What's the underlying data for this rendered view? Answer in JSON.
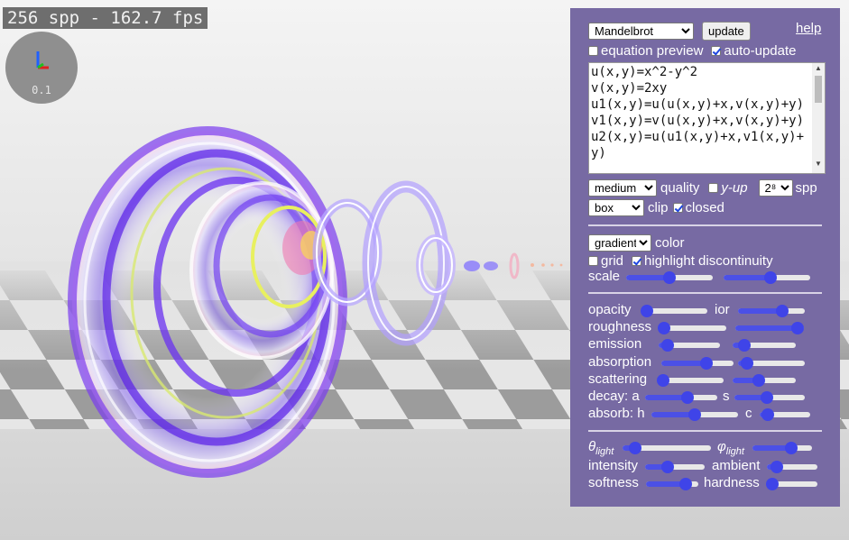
{
  "status": {
    "fps_text": "256 spp - 162.7 fps"
  },
  "gizmo": {
    "scale_label": "0.1"
  },
  "colors": {
    "panel_bg": "#776aa3",
    "slider_accent": "#3f44e8",
    "axis_x": "#e02020",
    "axis_y": "#2060ff",
    "axis_z": "#20c020"
  },
  "panel": {
    "preset": "Mandelbrot",
    "update_label": "update",
    "help_label": "help",
    "equation_preview": {
      "label": "equation preview",
      "checked": false
    },
    "auto_update": {
      "label": "auto-update",
      "checked": true
    },
    "equation_text": "u(x,y)=x^2-y^2\nv(x,y)=2xy\nu1(x,y)=u(u(x,y)+x,v(x,y)+y)\nv1(x,y)=v(u(x,y)+x,v(x,y)+y)\nu2(x,y)=u(u1(x,y)+x,v1(x,y)+y)",
    "quality_select": "medium",
    "quality_label": "quality",
    "y_up": {
      "label": "y-up",
      "checked": false
    },
    "spp_select": "2⁸",
    "spp_label": "spp",
    "clip_select": "box",
    "clip_label": "clip",
    "closed": {
      "label": "closed",
      "checked": true
    },
    "color_select": "gradient",
    "color_label": "color",
    "grid": {
      "label": "grid",
      "checked": false
    },
    "highlight": {
      "label": "highlight discontinuity",
      "checked": true
    },
    "scale_label": "scale",
    "scale_values": [
      0.5,
      0.55
    ],
    "material": {
      "opacity_label": "opacity",
      "opacity": 0.0,
      "ior_label": "ior",
      "ior": 0.7,
      "roughness_label": "roughness",
      "roughness": 0.0,
      "roughness2": 1.0,
      "emission_label": "emission",
      "emission": 0.05,
      "emission2": 0.1,
      "absorption_label": "absorption",
      "absorption": 0.65,
      "absorption2": 0.05,
      "scattering_label": "scattering",
      "scattering": 0.0,
      "scattering2": 0.4,
      "decay_a_label": "decay: a",
      "decay_a": 0.6,
      "s_label": "s",
      "s": 0.45,
      "absorb_h_label": "absorb: h",
      "absorb_h": 0.5,
      "c_label": "c",
      "c": 0.05
    },
    "light": {
      "theta_label": "θ",
      "theta_sub": "light",
      "theta": 0.08,
      "phi_label": "φ",
      "phi_sub": "light",
      "phi": 0.7,
      "intensity_label": "intensity",
      "intensity": 0.35,
      "ambient_label": "ambient",
      "ambient": 0.1,
      "softness_label": "softness",
      "softness": 0.85,
      "hardness_label": "hardness",
      "hardness": 0.0
    }
  }
}
